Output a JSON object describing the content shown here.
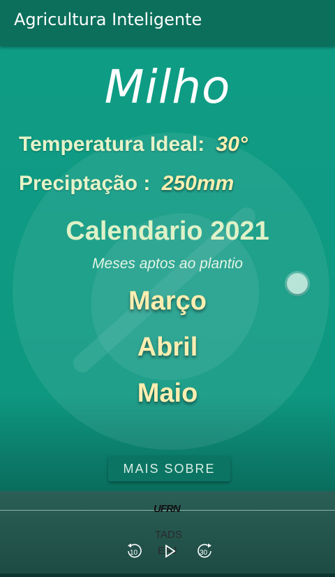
{
  "appbar": {
    "title": "Agricultura Inteligente"
  },
  "crop": {
    "name": "Milho",
    "temperature_label": "Temperatura Ideal:",
    "temperature_value": "30°",
    "precipitation_label": "Preciptação :",
    "precipitation_value": "250mm"
  },
  "calendar": {
    "title": "Calendario 2021",
    "subtitle": "Meses aptos ao plantio",
    "months": [
      "Março",
      "Abril",
      "Maio"
    ]
  },
  "actions": {
    "more_label": "MAIS SOBRE"
  },
  "footer": {
    "logo_text": "UFRN",
    "line1": "TADS",
    "line2": "EAJ",
    "rewind_label": "10",
    "forward_label": "30"
  },
  "colors": {
    "primary": "#0e9b84",
    "appbar": "#0b6f5c",
    "accent_text": "#ffefb0"
  }
}
